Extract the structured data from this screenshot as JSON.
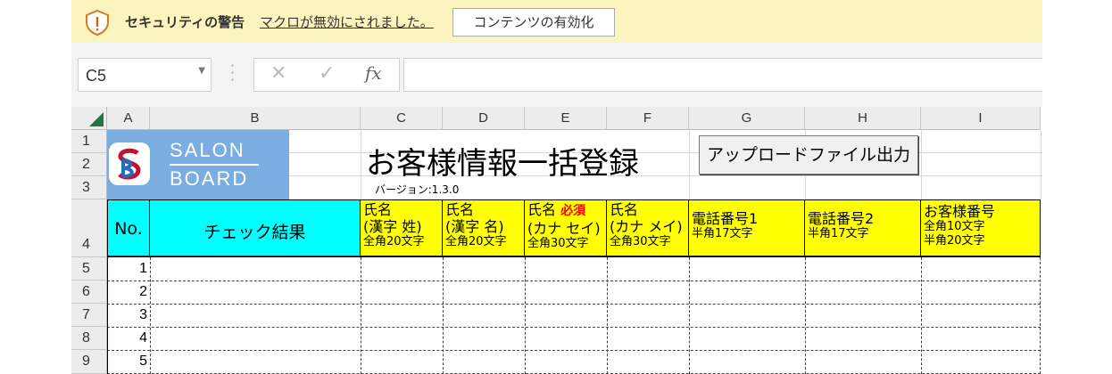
{
  "security_bar": {
    "title": "セキュリティの警告",
    "message": "マクロが無効にされました。",
    "button": "コンテンツの有効化",
    "icon": "shield-warning-icon"
  },
  "formula_bar": {
    "name_box": "C5",
    "cancel_icon": "✕",
    "enter_icon": "✓",
    "fx_label": "fx",
    "formula": ""
  },
  "columns": [
    "A",
    "B",
    "C",
    "D",
    "E",
    "F",
    "G",
    "H",
    "I"
  ],
  "rows": [
    "1",
    "2",
    "3",
    "4",
    "5",
    "6",
    "7",
    "8",
    "9"
  ],
  "sheet": {
    "logo_line1": "SALON",
    "logo_line2": "BOARD",
    "title": "お客様情報一括登録",
    "version": "バージョン:1.3.0",
    "upload_button": "アップロードファイル出力",
    "headers": {
      "no": "No.",
      "check": "チェック結果",
      "c": {
        "l1": "氏名",
        "l2": "(漢字 姓)",
        "l3": "全角20文字"
      },
      "d": {
        "l1": "氏名",
        "l2": "(漢字 名)",
        "l3": "全角20文字"
      },
      "e": {
        "l1": "氏名",
        "req": "必須",
        "l2": "(カナ セイ)",
        "l3": "全角30文字"
      },
      "f": {
        "l1": "氏名",
        "l2": "(カナ メイ)",
        "l3": "全角30文字"
      },
      "g": {
        "l1": "電話番号1",
        "l2": "半角17文字"
      },
      "h": {
        "l1": "電話番号2",
        "l2": "半角17文字"
      },
      "i": {
        "l1": "お客様番号",
        "l2": "全角10文字",
        "l3": "半角20文字"
      }
    },
    "data_rows": [
      "1",
      "2",
      "3",
      "4",
      "5"
    ]
  },
  "colors": {
    "security_bg": "#fcf4bf",
    "cyan_header": "#00ffff",
    "yellow_header": "#ffff00",
    "logo_bg": "#7aaee0",
    "required": "#ff0000"
  }
}
